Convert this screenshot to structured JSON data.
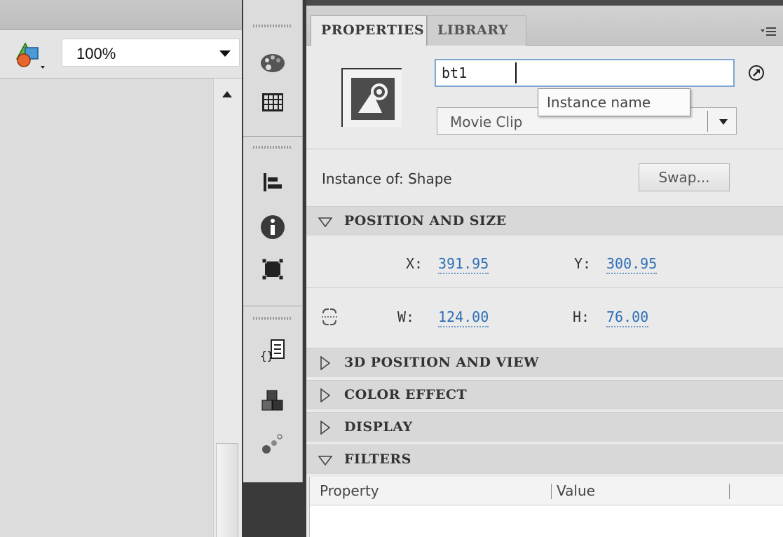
{
  "stage": {
    "zoom": "100%"
  },
  "properties": {
    "tabs": [
      {
        "label": "PROPERTIES"
      },
      {
        "label": "LIBRARY"
      }
    ],
    "instance_name": "bt1",
    "instance_name_tooltip": "Instance name",
    "symbol_type": "Movie Clip",
    "instance_of_label": "Instance of:",
    "instance_of_value": "Shape",
    "swap_label": "Swap...",
    "sections": {
      "position_size": "POSITION AND SIZE",
      "position_3d": "3D POSITION AND VIEW",
      "color_effect": "COLOR EFFECT",
      "display": "DISPLAY",
      "filters": "FILTERS"
    },
    "x_label": "X:",
    "x_value": "391.95",
    "y_label": "Y:",
    "y_value": "300.95",
    "w_label": "W:",
    "w_value": "124.00",
    "h_label": "H:",
    "h_value": "76.00",
    "filters_columns": {
      "property": "Property",
      "value": "Value"
    }
  },
  "icons": {
    "edit_symbols": "edit-symbols-icon",
    "strip": [
      "color-palette-icon",
      "swatches-icon",
      "align-icon",
      "info-icon",
      "transform-icon",
      "actions-icon",
      "components-icon",
      "motion-presets-icon"
    ],
    "link": "lock-proportions-icon",
    "go": "go-to-icon",
    "panel_menu": "panel-menu-icon"
  },
  "colors": {
    "link_value": "#2f6fb6",
    "input_focus": "#7aa6cf",
    "dark_strip": "#3a3a3a"
  }
}
